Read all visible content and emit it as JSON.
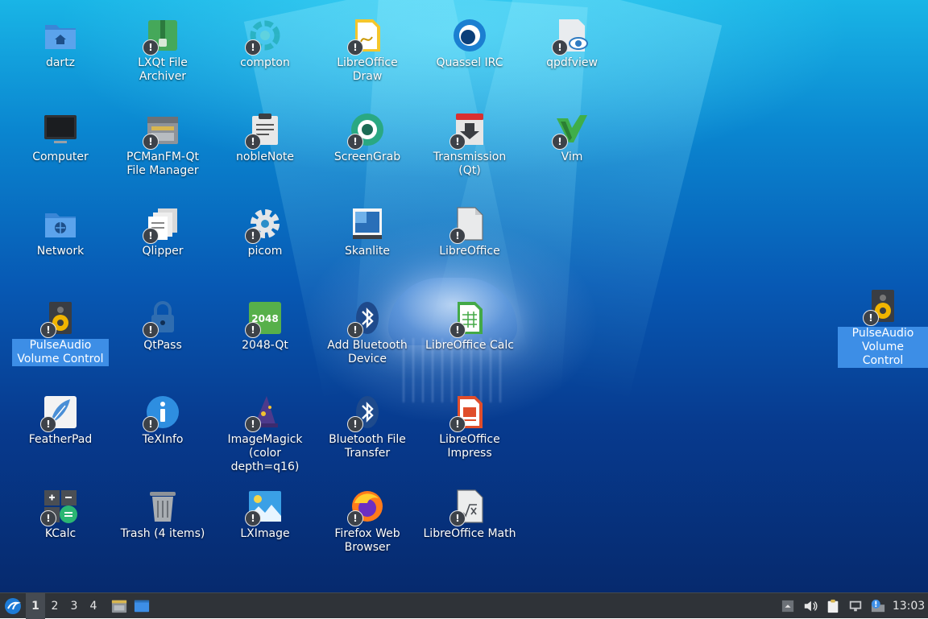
{
  "desktop": {
    "icons": [
      {
        "label": "dartz"
      },
      {
        "label": "LXQt File Archiver"
      },
      {
        "label": "compton"
      },
      {
        "label": "LibreOffice Draw"
      },
      {
        "label": "Quassel IRC"
      },
      {
        "label": "qpdfview"
      },
      {
        "label": "Computer"
      },
      {
        "label": "PCManFM-Qt File Manager"
      },
      {
        "label": "nobleNote"
      },
      {
        "label": "ScreenGrab"
      },
      {
        "label": "Transmission (Qt)"
      },
      {
        "label": "Vim"
      },
      {
        "label": "Network"
      },
      {
        "label": "Qlipper"
      },
      {
        "label": "picom"
      },
      {
        "label": "Skanlite"
      },
      {
        "label": "LibreOffice"
      },
      {
        "label": "PulseAudio Volume Control"
      },
      {
        "label": "QtPass"
      },
      {
        "label": "2048-Qt"
      },
      {
        "label": "Add Bluetooth Device"
      },
      {
        "label": "LibreOffice Calc"
      },
      {
        "label": "FeatherPad"
      },
      {
        "label": "TeXInfo"
      },
      {
        "label": "ImageMagick (color depth=q16)"
      },
      {
        "label": "Bluetooth File Transfer"
      },
      {
        "label": "LibreOffice Impress"
      },
      {
        "label": "KCalc"
      },
      {
        "label": "Trash (4 items)"
      },
      {
        "label": "LXImage"
      },
      {
        "label": "Firefox Web Browser"
      },
      {
        "label": "LibreOffice Math"
      },
      {
        "label": "PulseAudio Volume Control"
      }
    ],
    "emblem": "!",
    "glyph_2048": "2048"
  },
  "taskbar": {
    "desktops": [
      "1",
      "2",
      "3",
      "4"
    ],
    "active_desktop": "1",
    "clock": "13:03"
  },
  "colors": {
    "selection": "#3d8ee6",
    "taskbar": "#2f3338"
  }
}
